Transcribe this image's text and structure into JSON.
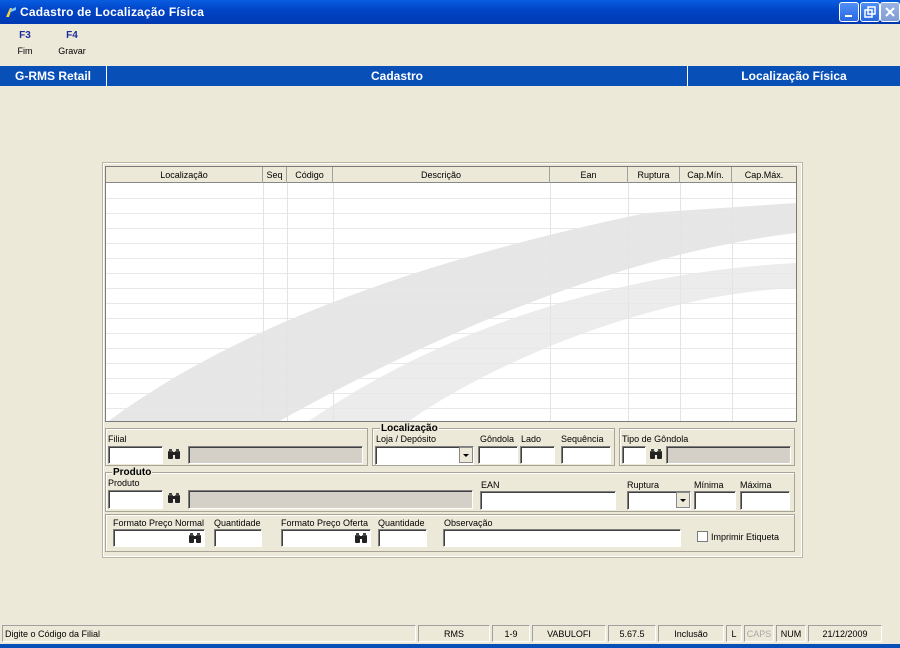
{
  "window": {
    "title": "Cadastro de Localização Física"
  },
  "fkeys": [
    {
      "key": "F3",
      "label": "Fim"
    },
    {
      "key": "F4",
      "label": "Gravar"
    }
  ],
  "band": {
    "left": "G-RMS Retail",
    "center": "Cadastro",
    "right": "Localização Física"
  },
  "grid": {
    "columns": [
      "Localização",
      "Seq",
      "Código",
      "Descrição",
      "Ean",
      "Ruptura",
      "Cap.Mín.",
      "Cap.Máx."
    ]
  },
  "form": {
    "filial_label": "Filial",
    "localizacao_title": "Localização",
    "loja_deposito_label": "Loja / Depósito",
    "gondola_label": "Gôndola",
    "lado_label": "Lado",
    "sequencia_label": "Sequência",
    "tipo_gondola_label": "Tipo de Gôndola",
    "produto_title": "Produto",
    "produto_label": "Produto",
    "ean_label": "EAN",
    "ruptura_label": "Ruptura",
    "minima_label": "Mínima",
    "maxima_label": "Máxima",
    "formato_normal_label": "Formato Preço Normal",
    "quantidade_label_1": "Quantidade",
    "formato_oferta_label": "Formato Preço Oferta",
    "quantidade_label_2": "Quantidade",
    "observacao_label": "Observação",
    "imprimir_label": "Imprimir Etiqueta"
  },
  "status": {
    "message": "Digite o Código da Filial",
    "system": "RMS",
    "range": "1-9",
    "user": "VABULOFI",
    "version": "5.67.5",
    "mode": "Inclusão",
    "l": "L",
    "caps": "CAPS",
    "num": "NUM",
    "date": "21/12/2009"
  },
  "icons": {
    "binoculars": "binoculars-icon",
    "dropdown": "chevron-down-icon",
    "app": "app-icon"
  },
  "colors": {
    "titlebar": "#0045c8",
    "band": "#0850b8",
    "background": "#ece9d8",
    "fkey": "#1b2c9e"
  }
}
